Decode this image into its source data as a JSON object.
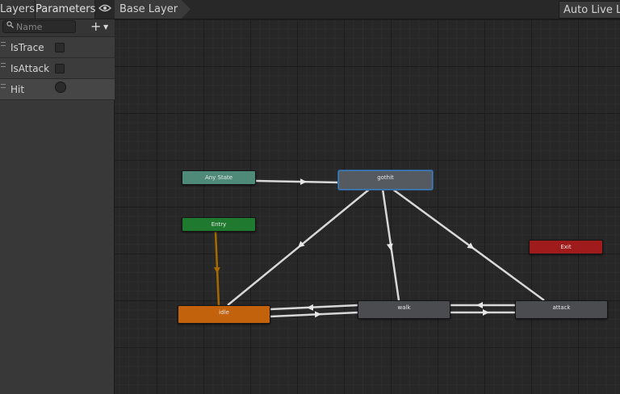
{
  "left_panel": {
    "tabs": {
      "layers": "Layers",
      "parameters": "Parameters"
    },
    "eye_icon": "eye-icon",
    "search": {
      "placeholder": "Name"
    },
    "add_button": "+",
    "parameters": [
      {
        "name": "IsTrace",
        "type": "bool"
      },
      {
        "name": "IsAttack",
        "type": "bool"
      },
      {
        "name": "Hit",
        "type": "trigger"
      }
    ]
  },
  "graph": {
    "breadcrumb": "Base Layer",
    "auto_live_link": "Auto Live Lin",
    "states": [
      {
        "id": "any",
        "label": "Any State",
        "color": "#4f8a78"
      },
      {
        "id": "gothit",
        "label": "gothit",
        "color": "#555a60",
        "selected": true
      },
      {
        "id": "entry",
        "label": "Entry",
        "color": "#1f7a2f"
      },
      {
        "id": "exit",
        "label": "Exit",
        "color": "#a01b1b"
      },
      {
        "id": "idle",
        "label": "idle",
        "color": "#c2620d",
        "default": true
      },
      {
        "id": "walk",
        "label": "walk",
        "color": "#4a4c50"
      },
      {
        "id": "attack",
        "label": "attack",
        "color": "#4a4c50"
      }
    ],
    "transitions": [
      {
        "from": "any",
        "to": "gothit"
      },
      {
        "from": "gothit",
        "to": "idle"
      },
      {
        "from": "gothit",
        "to": "walk"
      },
      {
        "from": "gothit",
        "to": "attack"
      },
      {
        "from": "entry",
        "to": "idle"
      },
      {
        "from": "walk",
        "to": "idle"
      },
      {
        "from": "idle",
        "to": "walk"
      },
      {
        "from": "attack",
        "to": "walk"
      },
      {
        "from": "walk",
        "to": "attack"
      }
    ]
  }
}
